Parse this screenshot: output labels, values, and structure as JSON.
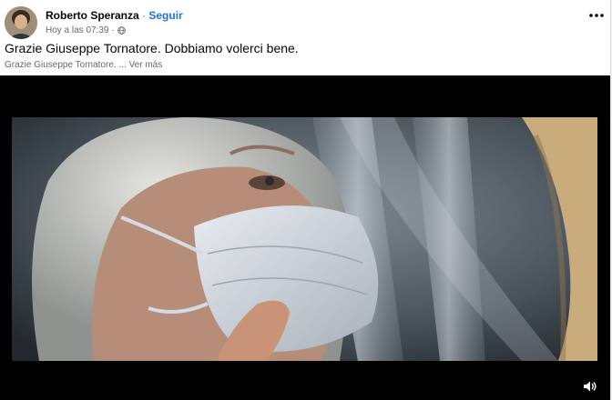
{
  "author": {
    "name": "Roberto Speranza",
    "separator": "·",
    "follow_label": "Seguir"
  },
  "meta": {
    "timestamp": "Hoy a las 07:39",
    "separator": "·",
    "audience_icon": "globe-icon"
  },
  "post": {
    "text": "Grazie Giuseppe Tornatore. Dobbiamo volerci bene.",
    "preview": "Grazie Giuseppe Tornatore. ... Ver más"
  },
  "icons": {
    "options": "more-options-icon",
    "volume": "volume-icon"
  },
  "colors": {
    "link": "#1b74e4",
    "text": "#050505",
    "secondary": "#65676b",
    "video_bg": "#000000"
  }
}
